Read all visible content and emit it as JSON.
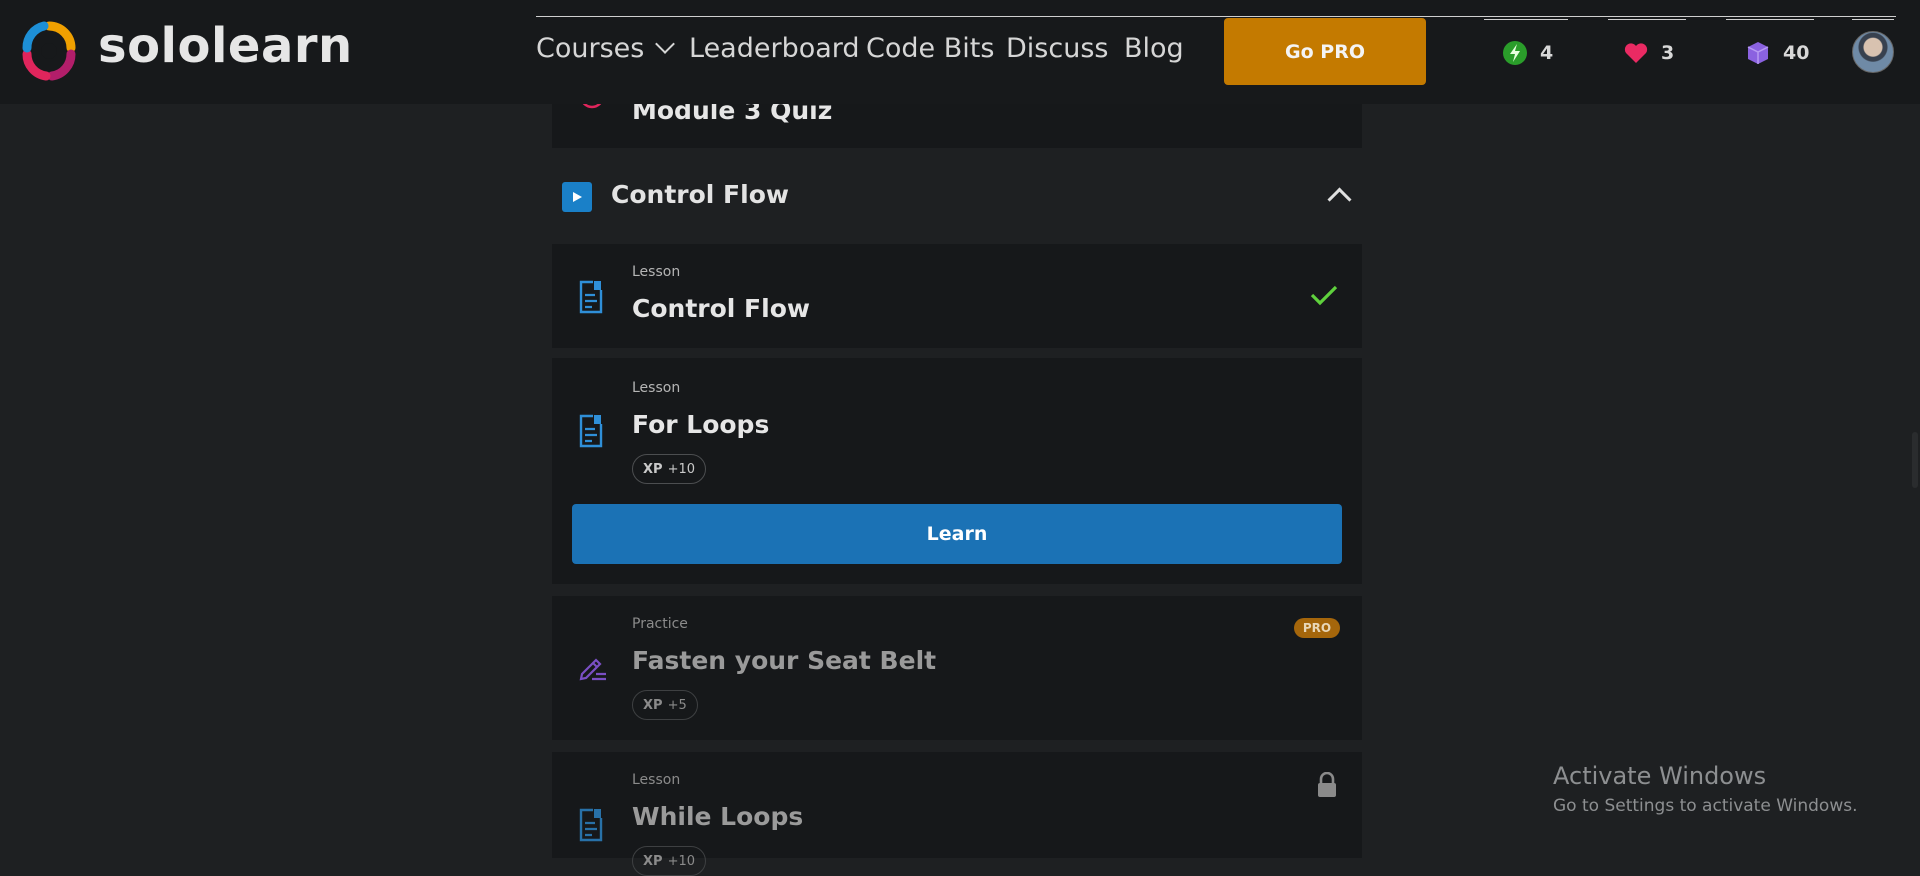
{
  "header": {
    "brand": "sololearn",
    "nav": {
      "courses": "Courses",
      "leaderboard": "Leaderboard",
      "code_bits": "Code Bits",
      "discuss": "Discuss",
      "blog": "Blog"
    },
    "go_pro": "Go PRO",
    "stats": {
      "streak": "4",
      "hearts": "3",
      "bits": "40"
    },
    "colors": {
      "go_pro": "#c47a00",
      "streak_icon": "#2a9d2a",
      "heart_icon": "#ea2a63",
      "bits_icon": "#8b62e0"
    }
  },
  "course": {
    "prev_item_title": "Module 3 Quiz",
    "section": {
      "title": "Control Flow",
      "icon": "play-icon",
      "expanded": true
    },
    "items": [
      {
        "type": "Lesson",
        "title": "Control Flow",
        "status": "completed",
        "icon": "lesson-doc-icon"
      },
      {
        "type": "Lesson",
        "title": "For Loops",
        "xp_label": "XP",
        "xp_value": "+10",
        "action": "Learn",
        "status": "current",
        "icon": "lesson-doc-icon"
      },
      {
        "type": "Practice",
        "title": "Fasten your Seat Belt",
        "xp_label": "XP",
        "xp_value": "+5",
        "badge": "PRO",
        "status": "pro-locked",
        "icon": "pencil-icon"
      },
      {
        "type": "Lesson",
        "title": "While Loops",
        "xp_label": "XP",
        "xp_value": "+10",
        "status": "locked",
        "icon": "lesson-doc-icon"
      }
    ]
  },
  "watermark": {
    "title": "Activate Windows",
    "subtitle": "Go to Settings to activate Windows."
  }
}
